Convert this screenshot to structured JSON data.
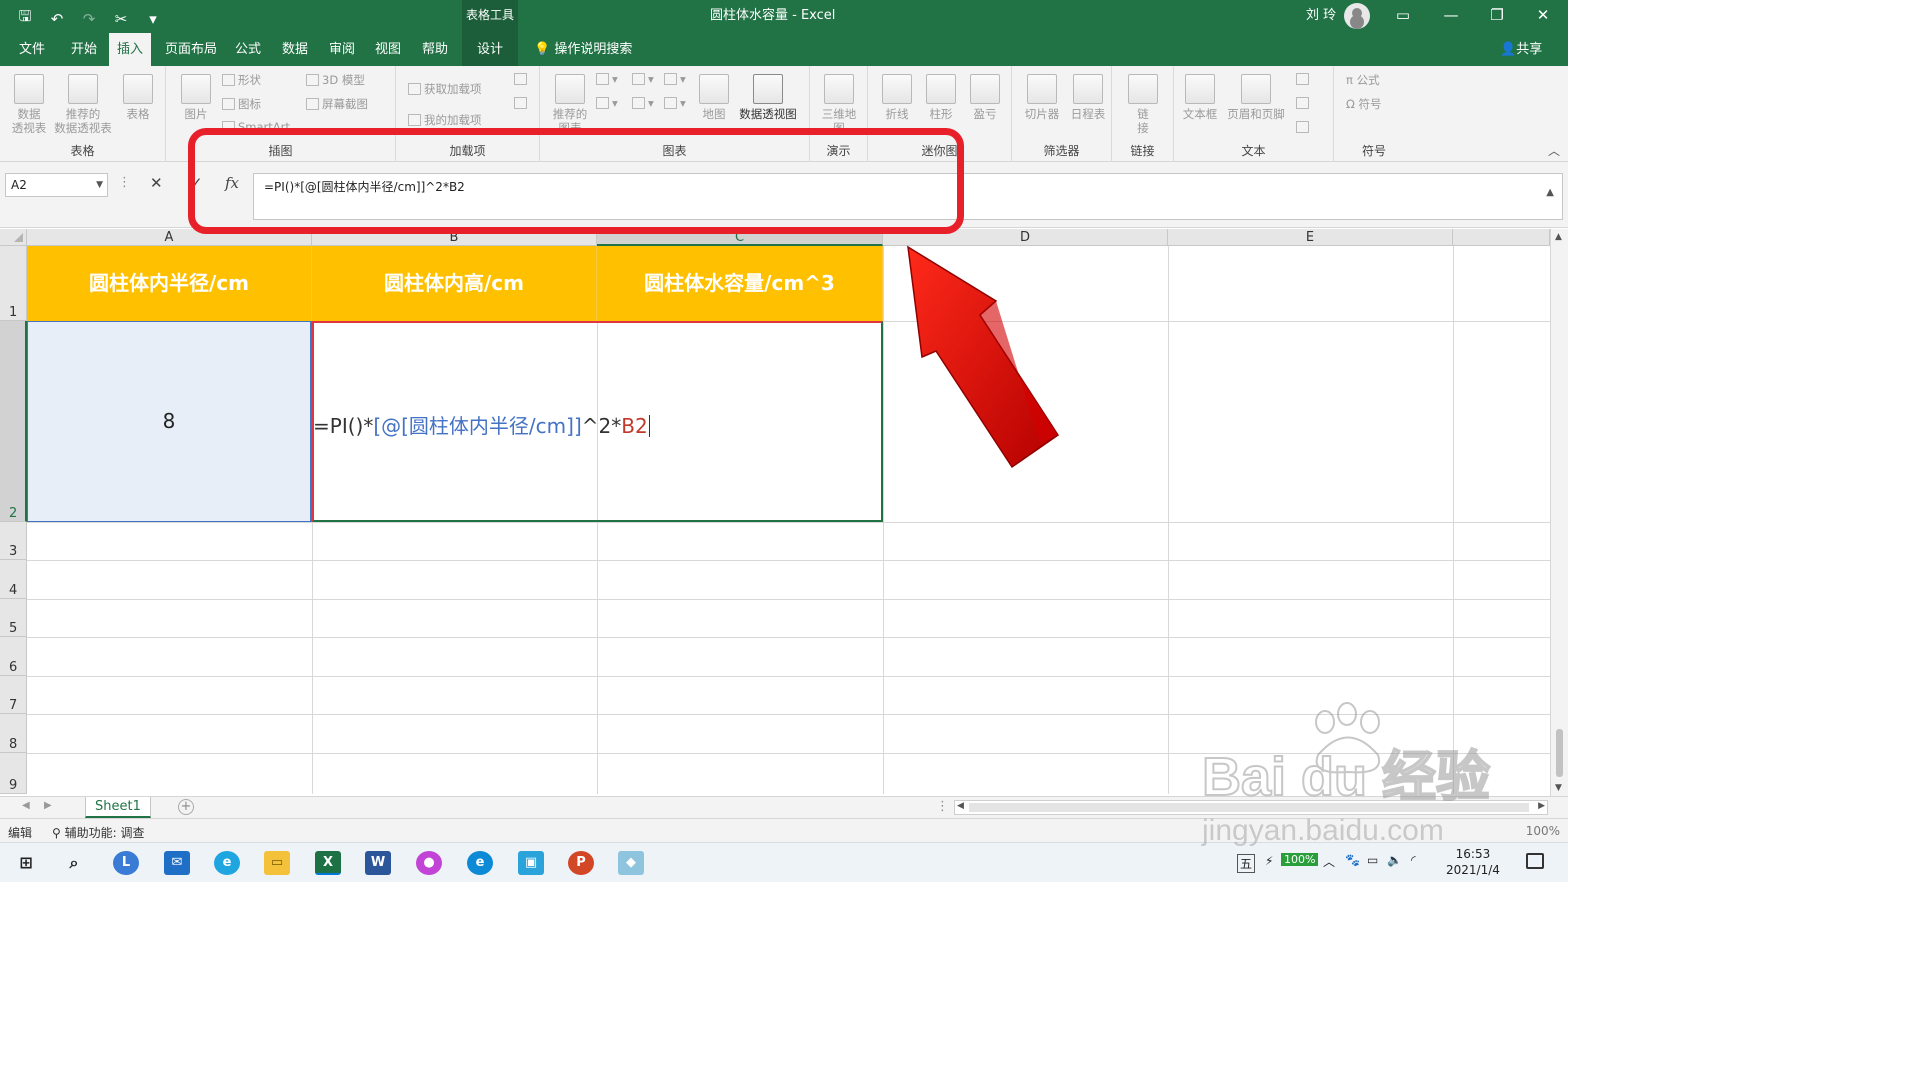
{
  "titlebar": {
    "tools_label": "表格工具",
    "title": "圆柱体水容量  -  Excel",
    "user": "刘 玲"
  },
  "tabs": [
    "文件",
    "开始",
    "插入",
    "页面布局",
    "公式",
    "数据",
    "审阅",
    "视图",
    "帮助",
    "设计"
  ],
  "active_tab": "插入",
  "tell_me": "操作说明搜索",
  "share": "共享",
  "ribbon": {
    "groups": {
      "tables": "表格",
      "illustrations": "插图",
      "addins": "加载项",
      "charts": "图表",
      "tours": "演示",
      "sparklines": "迷你图",
      "filters": "筛选器",
      "links": "链接",
      "text": "文本",
      "symbols": "符号"
    },
    "buttons": {
      "pivot_table": "数据\n透视表",
      "recommended_pivot": "推荐的\n数据透视表",
      "table": "表格",
      "pictures": "图片",
      "shapes": "形状",
      "icons": "图标",
      "models_3d": "3D 模型",
      "screenshot": "屏幕截图",
      "smartart": "SmartArt",
      "get_addins": "获取加载项",
      "my_addins": "我的加载项",
      "recommended_charts": "推荐的\n图表",
      "map": "地图",
      "pivot_chart": "数据透视图",
      "map_3d": "三维地\n图",
      "line": "折线",
      "column": "柱形",
      "win_loss": "盈亏",
      "slicer": "切片器",
      "timeline": "日程表",
      "link": "链\n接",
      "textbox": "文本框",
      "header_footer": "页眉和页脚",
      "equation": "公式",
      "symbol": "符号"
    }
  },
  "formula_bar": {
    "name_box": "A2",
    "formula": "=PI()*[@[圆柱体内半径/cm]]^2*B2",
    "fx": "fx"
  },
  "columns": [
    "A",
    "B",
    "C",
    "D",
    "E"
  ],
  "rows": [
    "1",
    "2",
    "3",
    "4",
    "5",
    "6",
    "7",
    "8",
    "9"
  ],
  "table": {
    "headers": [
      "圆柱体内半径/cm",
      "圆柱体内高/cm",
      "圆柱体水容量/cm^3"
    ],
    "a2_value": "8",
    "edit": {
      "prefix": "=PI()*",
      "ref_structured": "[@[圆柱体内半径/cm]]",
      "op": "^2*",
      "ref_cell": "B2"
    }
  },
  "sheet_tab": "Sheet1",
  "status": {
    "mode": "编辑",
    "accessibility": "辅助功能: 调查",
    "zoom": "100%"
  },
  "taskbar": {
    "battery": "100%",
    "ime": "五",
    "time": "16:53",
    "date": "2021/1/4"
  },
  "watermark": {
    "brand": "Bai  du 经验",
    "url": "jingyan.baidu.com"
  },
  "colors": {
    "excel_green": "#217346",
    "header_fill": "#ffc000",
    "highlight_red": "#e8202a",
    "ref_blue": "#4472c4"
  }
}
